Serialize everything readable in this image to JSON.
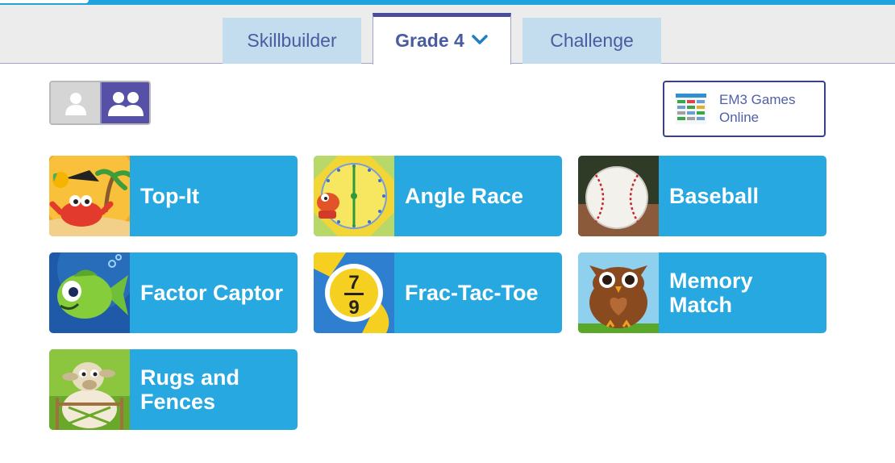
{
  "tabs": [
    {
      "label": "Skillbuilder",
      "active": false
    },
    {
      "label": "Grade 4",
      "active": true
    },
    {
      "label": "Challenge",
      "active": false
    }
  ],
  "player_toggle": {
    "single_icon": "single-user-icon",
    "multi_icon": "two-users-icon",
    "selected": "multi"
  },
  "em3_link": {
    "line1": "EM3 Games",
    "line2": "Online"
  },
  "games": [
    {
      "label": "Top-It",
      "icon": "crab-pirate-thumbnail"
    },
    {
      "label": "Angle Race",
      "icon": "protractor-dial-thumbnail"
    },
    {
      "label": "Baseball",
      "icon": "baseball-thumbnail"
    },
    {
      "label": "Factor Captor",
      "icon": "fish-thumbnail"
    },
    {
      "label": "Frac-Tac-Toe",
      "icon": "fraction-seven-ninths-thumbnail"
    },
    {
      "label": "Memory Match",
      "icon": "owl-thumbnail"
    },
    {
      "label": "Rugs and Fences",
      "icon": "sheep-thumbnail"
    }
  ],
  "colors": {
    "accent": "#27a8e0",
    "tab_text": "#4a5ca0",
    "tab_inactive_bg": "#c4ddee",
    "toggle_active": "#5651a6"
  }
}
